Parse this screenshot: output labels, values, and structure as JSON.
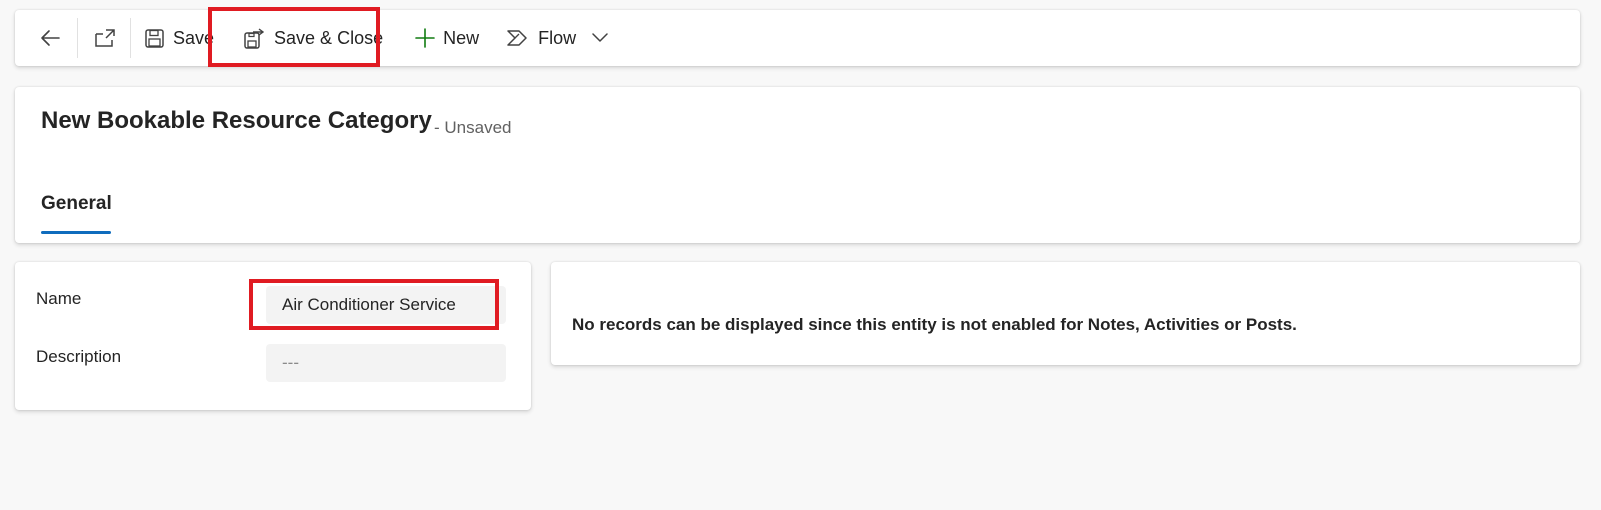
{
  "toolbar": {
    "back_icon": "arrow-left-icon",
    "open_icon": "open-in-new-window-icon",
    "save_label": "Save",
    "save_icon": "save-icon",
    "save_close_label": "Save & Close",
    "save_close_icon": "save-and-close-icon",
    "new_label": "New",
    "new_icon": "plus-icon",
    "flow_label": "Flow",
    "flow_icon": "flow-icon",
    "flow_dropdown_icon": "chevron-down-icon"
  },
  "header": {
    "title": "New Bookable Resource Category",
    "status": "- Unsaved",
    "tabs": [
      {
        "label": "General",
        "selected": true
      }
    ]
  },
  "form": {
    "fields": [
      {
        "label": "Name",
        "value": "Air Conditioner Service"
      },
      {
        "label": "Description",
        "value": "---"
      }
    ]
  },
  "timeline": {
    "message": "No records can be displayed since this entity is not enabled for Notes, Activities or Posts."
  },
  "colors": {
    "accent": "#0f6cbd",
    "highlight": "#e01b22",
    "new_icon": "#107c10",
    "background": "#f8f8f8"
  }
}
